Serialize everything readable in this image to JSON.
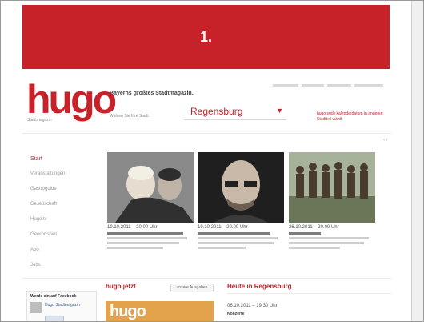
{
  "banner": {
    "label": "1."
  },
  "logo": {
    "text": "hugo"
  },
  "header": {
    "tagline": "Bayerns größtes Stadtmagazin.",
    "city_label": "Wählen Sie Ihre Stadt:",
    "city_value": "Regensburg",
    "calendar_link": "hugo.such kalenderdatum in anderen Stadtteil wählt"
  },
  "nav": {
    "items": [
      {
        "label": "Start",
        "active": true
      },
      {
        "label": "Veranstaltungen",
        "active": false
      },
      {
        "label": "Gastroguide",
        "active": false
      },
      {
        "label": "Gesellschaft",
        "active": false
      },
      {
        "label": "Hugo.tv",
        "active": false
      },
      {
        "label": "Gewinnspiel",
        "active": false
      },
      {
        "label": "Abo",
        "active": false
      },
      {
        "label": "Jobs",
        "active": false
      }
    ]
  },
  "featured": [
    {
      "date": "19.10.2011 – 20.00 Uhr"
    },
    {
      "date": "19.10.2011 – 20.00 Uhr"
    },
    {
      "date": "26.10.2011 – 20.00 Uhr"
    }
  ],
  "sections": {
    "hugo_jetzt": "hugo jetzt",
    "more_button": "unsere Ausgaben",
    "heute": "Heute in Regensburg"
  },
  "facebook": {
    "title": "Werde ein auf Facebook",
    "name": "Hugo Stadtmagazin"
  },
  "cover": {
    "title": "hugo"
  },
  "event": {
    "date": "06.10.2011 – 19.30 Uhr",
    "name": "Konzerte"
  },
  "colors": {
    "brand": "#c7222a"
  }
}
